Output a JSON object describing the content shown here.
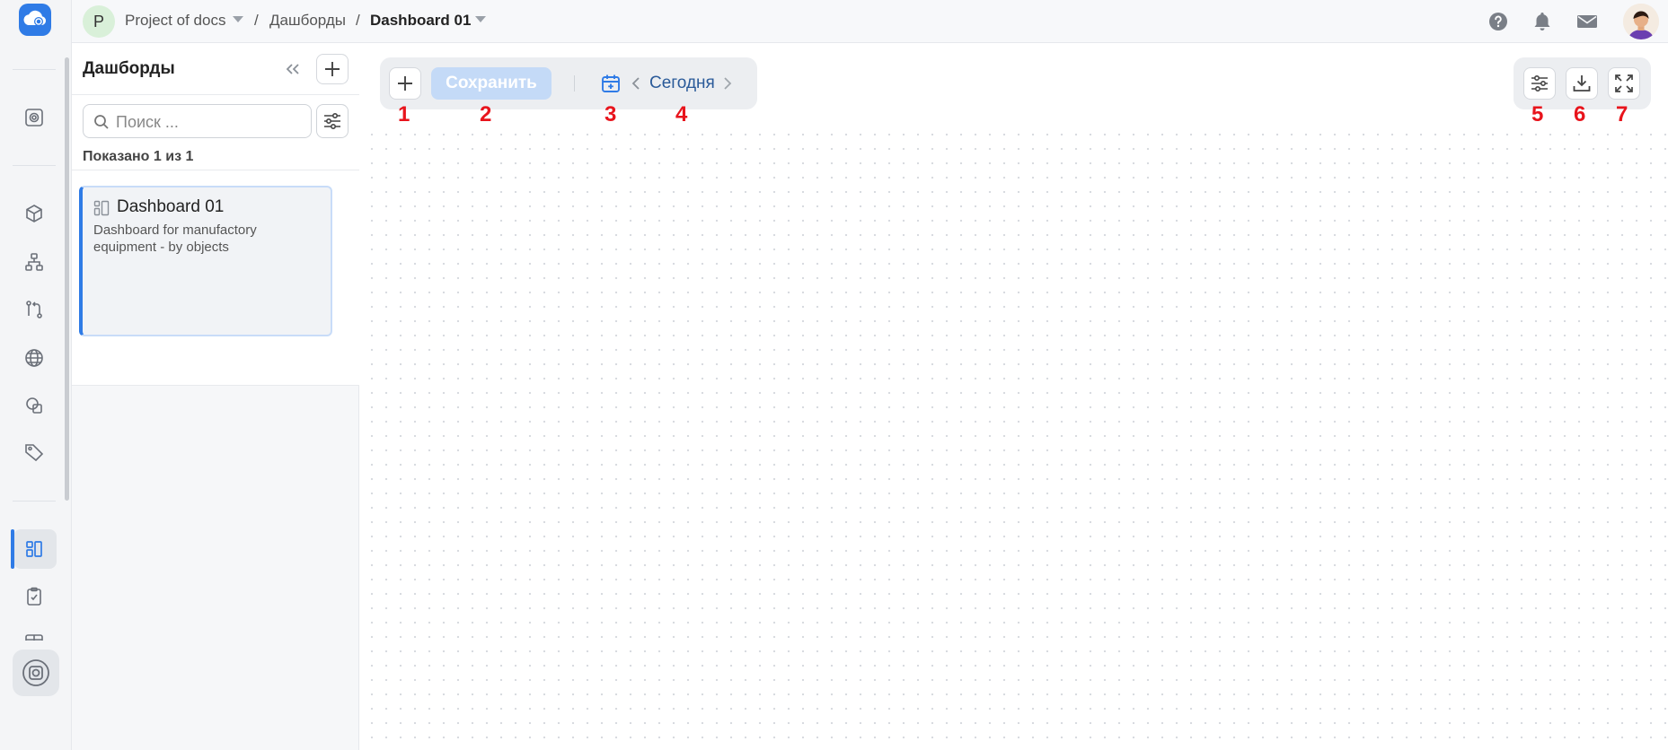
{
  "breadcrumb": {
    "project_initial": "P",
    "project": "Project of docs",
    "separator": "/",
    "section": "Дашборды",
    "current": "Dashboard 01"
  },
  "panel": {
    "title": "Дашборды",
    "search_placeholder": "Поиск ...",
    "shown_count": "Показано 1 из 1",
    "items": [
      {
        "title": "Dashboard 01",
        "description": "Dashboard for manufactory equipment - by objects"
      }
    ]
  },
  "toolbar": {
    "save_label": "Сохранить",
    "date_label": "Сегодня"
  },
  "markers": [
    "1",
    "2",
    "3",
    "4",
    "5",
    "6",
    "7"
  ],
  "icons": {
    "rail": [
      "app-logo-icon",
      "sensor-icon",
      "cube-icon",
      "hierarchy-icon",
      "git-compare-icon",
      "globe-icon",
      "shapes-icon",
      "tag-icon",
      "dashboard-icon",
      "clipboard-check-icon",
      "table-icon",
      "sensor-icon"
    ],
    "topbar": [
      "help-icon",
      "bell-icon",
      "mail-icon"
    ],
    "right_toolbar": [
      "settings-sliders-icon",
      "download-icon",
      "fullscreen-icon"
    ]
  },
  "colors": {
    "accent": "#2f7be6",
    "save_disabled": "#c4daf7",
    "marker": "#e8141c",
    "date_text": "#2a5a99"
  }
}
